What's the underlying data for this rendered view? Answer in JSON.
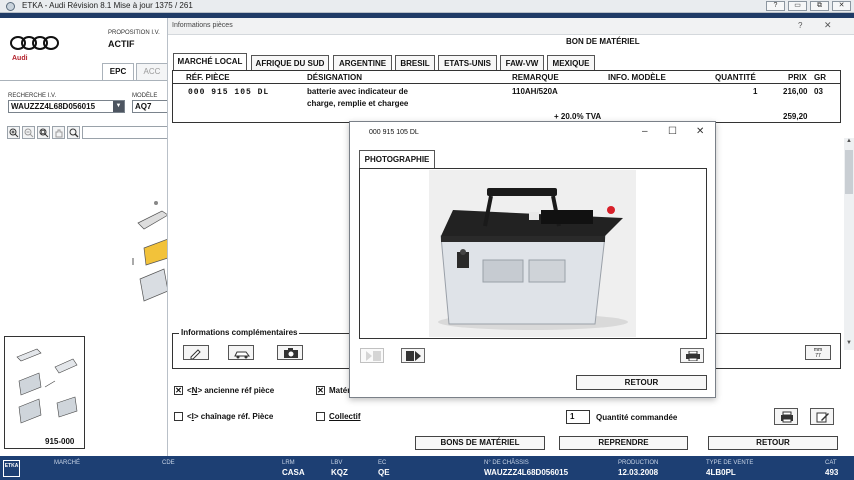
{
  "window": {
    "title": "ETKA - Audi Révision 8.1 Mise à jour 1375 / 261",
    "controls": [
      "?",
      "▭",
      "⧉",
      "✕"
    ]
  },
  "left": {
    "brand": "Audi",
    "proposition_label": "PROPOSITION I.V.",
    "proposition_value": "ACTIF",
    "tabs": [
      "EPC",
      "ACC"
    ],
    "recherche_label": "RECHERCHE I.V.",
    "recherche_value": "WAUZZZ4L68D056015",
    "modele_label": "MODÈLE",
    "modele_value": "AQ7",
    "thumb_label": "915-000"
  },
  "info": {
    "title": "Informations pièces",
    "help": "?",
    "close": "✕",
    "bon_title": "BON DE MATÉRIEL",
    "market_tabs": [
      "MARCHÉ LOCAL",
      "AFRIQUE DU SUD",
      "ARGENTINE",
      "BRESIL",
      "ETATS-UNIS",
      "FAW-VW",
      "MEXIQUE"
    ],
    "columns": {
      "ref": "RÉF. PIÈCE",
      "designation": "DÉSIGNATION",
      "remarque": "REMARQUE",
      "info_modele": "INFO. MODÈLE",
      "quantite": "QUANTITÉ",
      "prix": "PRIX",
      "gr": "GR"
    },
    "row": {
      "ref": "000 915 105 DL",
      "designation_1": "batterie avec indicateur de",
      "designation_2": "charge, remplie et chargee",
      "remarque": "110AH/520A",
      "quantite": "1",
      "prix": "216,00",
      "gr": "03",
      "tva_label": "+ 20.0% TVA",
      "prix_tva": "259,20"
    },
    "complementaires_label": "Informations complémentaires",
    "mm_button": "mm\n77",
    "checkboxes": {
      "ancienne_pre": "<",
      "ancienne_key": "N",
      "ancienne_post": "> ancienne réf pièce",
      "ancienne_checked": "✕",
      "materiel": "Matériel",
      "materiel_checked": "✕",
      "chainage_pre": "<",
      "chainage_key": "I",
      "chainage_post": "> chaînage réf. Pièce",
      "collectif": "Collectif"
    },
    "quantity_value": "1",
    "quantity_label": "Quantité commandée",
    "buttons": {
      "bons": "BONS DE MATÉRIEL",
      "reprendre": "REPRENDRE",
      "retour": "RETOUR"
    }
  },
  "photo": {
    "title": "000 915 105 DL",
    "tab": "PHOTOGRAPHIE",
    "retour": "RETOUR"
  },
  "status": {
    "logo": "ETKA",
    "marche_label": "MARCHÉ",
    "cde_label": "CDE",
    "lrm_label": "LRM",
    "lrm_value": "CASA",
    "lbv_label": "LBV",
    "lbv_value": "KQZ",
    "ec_label": "EC",
    "ec_value": "QE",
    "chassis_label": "N° DE CHÂSSIS",
    "chassis_value": "WAUZZZ4L68D056015",
    "production_label": "PRODUCTION",
    "production_value": "12.03.2008",
    "type_label": "TYPE DE VENTE",
    "type_value": "4LB0PL",
    "cat_label": "CAT",
    "cat_value": "493"
  },
  "colors": {
    "status_bg": "#1d3f73",
    "audi_red": "#b21f2a",
    "battery_cap": "#d8202a"
  }
}
